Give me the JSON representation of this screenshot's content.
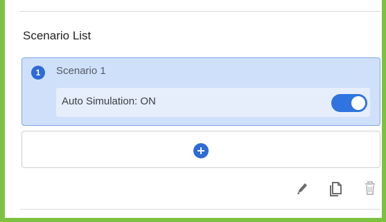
{
  "section": {
    "title": "Scenario List"
  },
  "scenarios": [
    {
      "number": "1",
      "name": "Scenario 1",
      "auto_simulation_label": "Auto Simulation: ON",
      "auto_simulation_on": true
    }
  ],
  "icons": {
    "add": "plus-circle-icon",
    "edit": "pencil-icon",
    "copy": "copy-icon",
    "delete": "trash-icon"
  },
  "colors": {
    "frame_border": "#7dc142",
    "accent": "#2f6bd6",
    "selected_card_bg": "#cfe0fb",
    "toggle_on": "#2f74e0",
    "delete_disabled": "#bdbdbd"
  }
}
